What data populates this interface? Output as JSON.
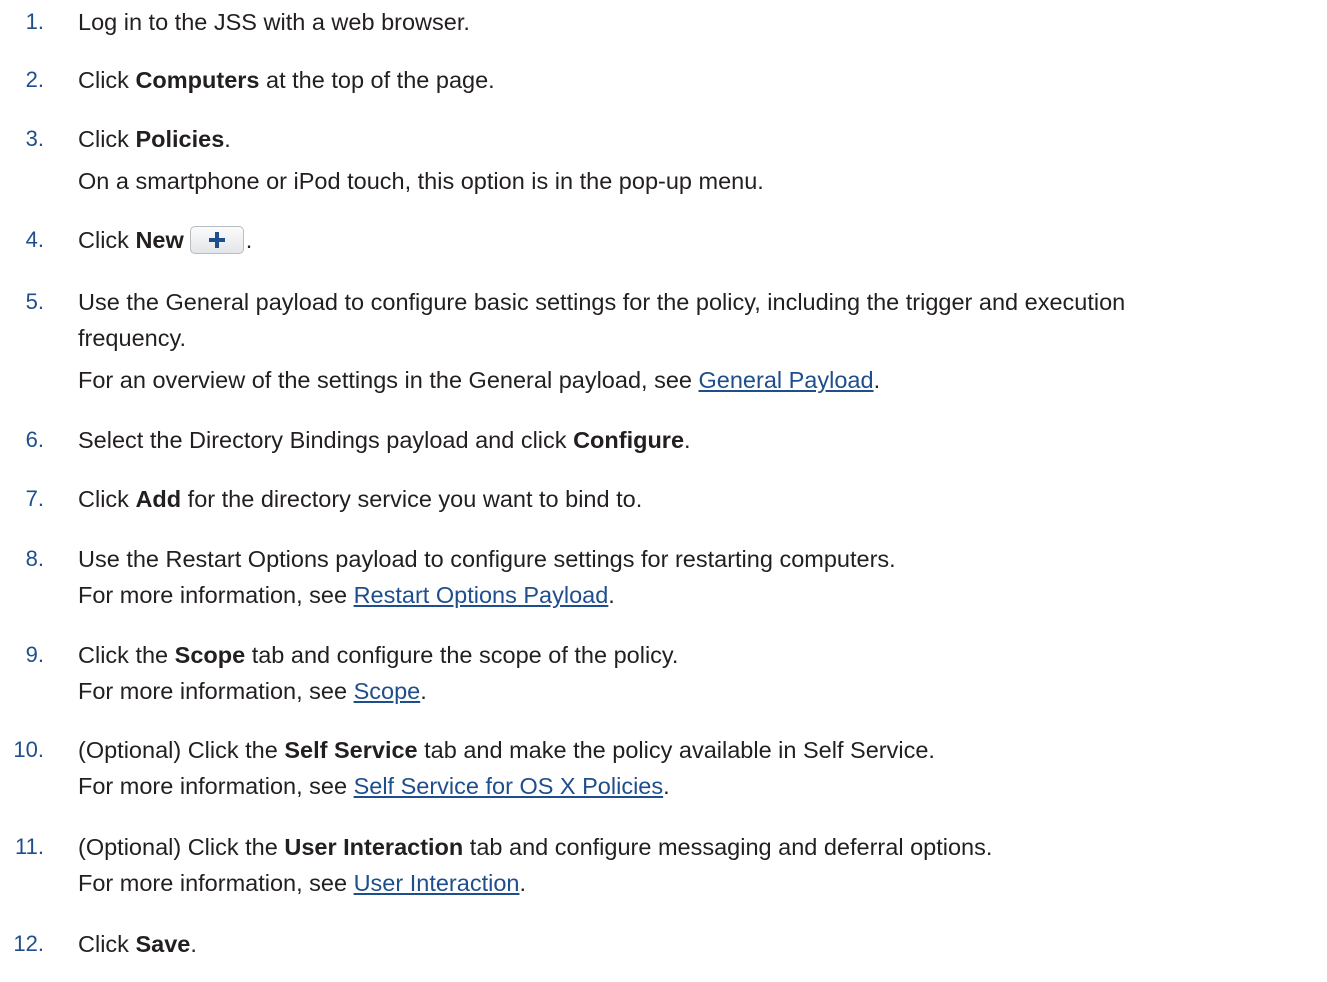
{
  "steps": [
    {
      "num": "1.",
      "pre": "Log in to the JSS with a web browser."
    },
    {
      "num": "2.",
      "pre": "Click ",
      "bold": "Computers",
      "post": " at the top of the page."
    },
    {
      "num": "3.",
      "pre": "Click ",
      "bold": "Policies",
      "post": ".",
      "sub": "On a smartphone or iPod touch, this option is in the pop-up menu."
    },
    {
      "num": "4.",
      "pre": "Click ",
      "bold": "New",
      "post": ".",
      "icon": "plus-icon"
    },
    {
      "num": "5.",
      "line1": "Use the General payload to configure basic settings for the policy, including the trigger and execution",
      "line2": "frequency.",
      "sub_pre": "For an overview of the settings in the General payload, see ",
      "sub_link": "General Payload",
      "sub_post": "."
    },
    {
      "num": "6.",
      "pre": "Select the Directory Bindings payload and click ",
      "bold": "Configure",
      "post": "."
    },
    {
      "num": "7.",
      "pre": "Click ",
      "bold": "Add",
      "post": " for the directory service you want to bind to."
    },
    {
      "num": "8.",
      "pre": "Use the Restart Options payload to configure settings for restarting computers.",
      "sub_pre": "For more information, see ",
      "sub_link": "Restart Options Payload",
      "sub_post": "."
    },
    {
      "num": "9.",
      "pre": "Click the ",
      "bold": "Scope",
      "post": " tab and configure the scope of the policy.",
      "sub_pre": "For more information, see ",
      "sub_link": "Scope",
      "sub_post": "."
    },
    {
      "num": "10.",
      "pre": "(Optional) Click the ",
      "bold": "Self Service",
      "post": " tab and make the policy available in Self Service.",
      "sub_pre": "For more information, see ",
      "sub_link": "Self Service for OS X Policies",
      "sub_post": "."
    },
    {
      "num": "11.",
      "pre": "(Optional) Click the ",
      "bold": "User Interaction",
      "post": " tab and configure messaging and deferral options.",
      "sub_pre": "For more information, see ",
      "sub_link": "User Interaction",
      "sub_post": "."
    },
    {
      "num": "12.",
      "pre": "Click ",
      "bold": "Save",
      "post": "."
    }
  ],
  "colors": {
    "number": "#1f4e8c",
    "link": "#1f4e8c",
    "text": "#231f20",
    "icon": "#1f4e8c"
  }
}
